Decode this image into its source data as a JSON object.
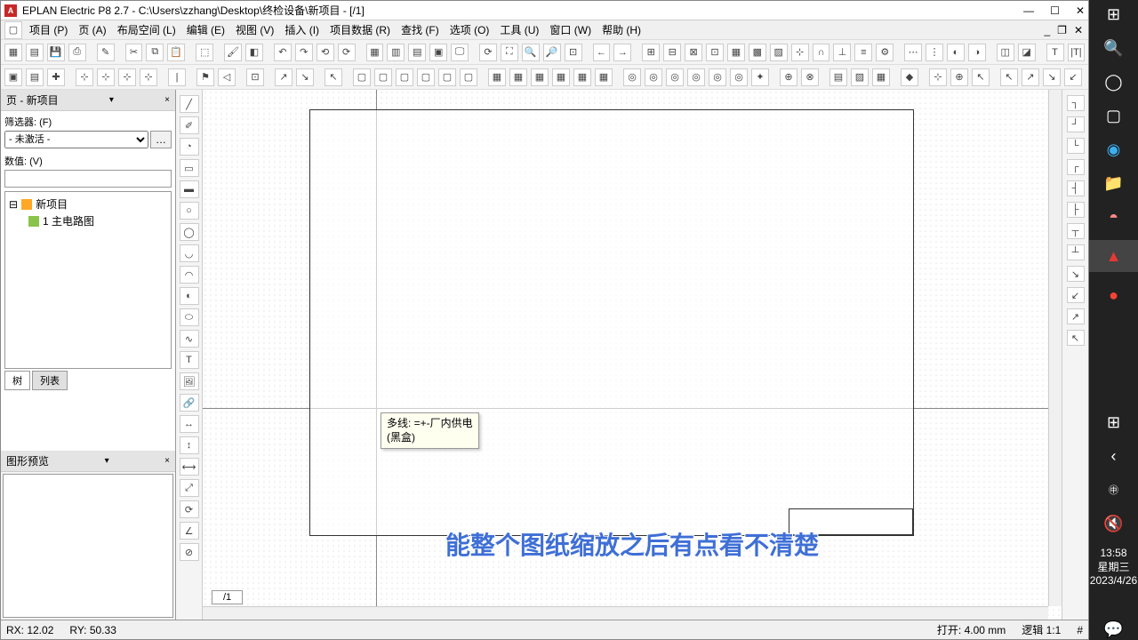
{
  "title": "EPLAN Electric P8 2.7 - C:\\Users\\zzhang\\Desktop\\终检设备\\新项目 - [/1]",
  "menu": {
    "project": "项目 (P)",
    "page": "页 (A)",
    "layout": "布局空间 (L)",
    "edit": "编辑 (E)",
    "view": "视图 (V)",
    "insert": "插入 (I)",
    "project_data": "项目数据 (R)",
    "find": "查找 (F)",
    "options": "选项 (O)",
    "tools": "工具 (U)",
    "window": "窗口 (W)",
    "help": "帮助 (H)"
  },
  "left_panel": {
    "header": "页 - 新项目",
    "filter_label": "筛选器: (F)",
    "filter_value": "- 未激活 -",
    "value_label": "数值: (V)",
    "value_input": "",
    "tree": {
      "root": "新项目",
      "child": "1 主电路图"
    },
    "tab_tree": "树",
    "tab_list": "列表",
    "preview_header": "图形预览"
  },
  "tooltip": {
    "line1": "多线: =+-厂内供电",
    "line2": "(黑盒)"
  },
  "sheet_tab": "/1",
  "status": {
    "rx": "RX: 12.02",
    "ry": "RY: 50.33",
    "open": "打开: 4.00 mm",
    "logic": "逻辑 1:1",
    "hash": "#"
  },
  "subtitle": "能整个图纸缩放之后有点看不清楚",
  "taskbar": {
    "time": "13:58",
    "weekday": "星期三",
    "date": "2023/4/26"
  }
}
